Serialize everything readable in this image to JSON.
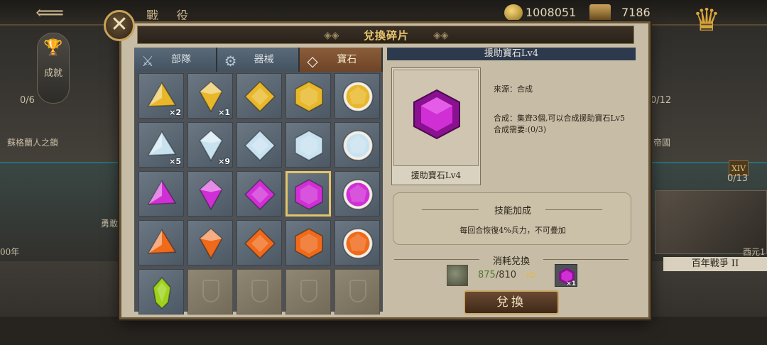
{
  "background": {
    "title": "戰 役",
    "gold": "1008051",
    "other_currency": "7186",
    "trophy_label": "成就",
    "left": {
      "count": "0/6",
      "name": "蘇格蘭人之鎖",
      "name2": "勇敢",
      "year": "00年"
    },
    "right": {
      "count1": "0/12",
      "name1": "帝國",
      "roman": "XIV",
      "count2": "0/13",
      "year": "西元1",
      "name2": "百年戰爭 II"
    }
  },
  "dialog": {
    "title": "兌換碎片",
    "close_icon": "close-icon",
    "tabs": [
      {
        "label": "部隊",
        "icon": "crossed-swords-icon",
        "active": false
      },
      {
        "label": "器械",
        "icon": "siege-icon",
        "active": false
      },
      {
        "label": "寶石",
        "icon": "diamond-icon",
        "active": true
      }
    ],
    "gems": [
      {
        "color": "#e8b82a",
        "shape": "tri",
        "qty": "×2"
      },
      {
        "color": "#e8b82a",
        "shape": "kite",
        "qty": "×1"
      },
      {
        "color": "#e8b82a",
        "shape": "rhombus",
        "qty": ""
      },
      {
        "color": "#e8b82a",
        "shape": "hex",
        "qty": ""
      },
      {
        "color": "#e8b82a",
        "shape": "round",
        "qty": ""
      },
      {
        "color": "#c9e2f0",
        "shape": "tri",
        "qty": "×5"
      },
      {
        "color": "#c9e2f0",
        "shape": "kite",
        "qty": "×9"
      },
      {
        "color": "#c9e2f0",
        "shape": "rhombus",
        "qty": ""
      },
      {
        "color": "#c9e2f0",
        "shape": "hex",
        "qty": ""
      },
      {
        "color": "#c9e2f0",
        "shape": "round",
        "qty": ""
      },
      {
        "color": "#d12fd6",
        "shape": "tri",
        "qty": ""
      },
      {
        "color": "#d12fd6",
        "shape": "kite",
        "qty": ""
      },
      {
        "color": "#d12fd6",
        "shape": "rhombus",
        "qty": ""
      },
      {
        "color": "#d12fd6",
        "shape": "hex",
        "qty": "",
        "selected": true
      },
      {
        "color": "#d12fd6",
        "shape": "round",
        "qty": ""
      },
      {
        "color": "#f06a1a",
        "shape": "tri",
        "qty": ""
      },
      {
        "color": "#f06a1a",
        "shape": "kite",
        "qty": ""
      },
      {
        "color": "#f06a1a",
        "shape": "rhombus",
        "qty": ""
      },
      {
        "color": "#f06a1a",
        "shape": "hex",
        "qty": ""
      },
      {
        "color": "#f06a1a",
        "shape": "round",
        "qty": ""
      },
      {
        "color": "#9ed21c",
        "shape": "leaf",
        "qty": ""
      },
      {
        "empty": true
      },
      {
        "empty": true
      },
      {
        "empty": true
      },
      {
        "empty": true
      }
    ],
    "detail": {
      "header": "援助寶石Lv4",
      "item_name": "援助寶石Lv4",
      "item_color": "#d12fd6",
      "source": "來源：合成",
      "compose_line1": "合成：集齊3個,可以合成援助寶石Lv5",
      "compose_line2": "合成需要:(0/3)",
      "skill_title": "技能加成",
      "skill_desc": "每回合恢復4%兵力，不可疊加",
      "consume_title": "消耗兌換",
      "have": "875",
      "need": "/810",
      "result_qty": "×1",
      "exchange_label": "兌換"
    }
  }
}
